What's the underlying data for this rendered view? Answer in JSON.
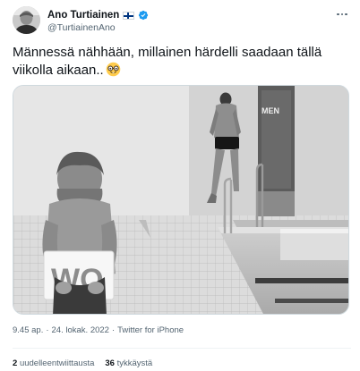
{
  "user": {
    "display_name": "Ano Turtiainen",
    "handle": "@TurtiainenAno",
    "flag": "finland-flag-icon",
    "verified_badge": "verified-badge-icon"
  },
  "tweet": {
    "text": "Männessä nähhään, millainen härdelli saadaan tällä\nviikolla aikaan..",
    "emoji": "nerd-face-icon",
    "media_alt": "",
    "media_signs": {
      "door_sign": "MEN",
      "towel_letters": "WO"
    }
  },
  "meta": {
    "time": "9.45 ap.",
    "date": "24. lokak. 2022",
    "source": "Twitter for iPhone",
    "separator": "·"
  },
  "stats": {
    "retweets_count": "2",
    "retweets_label": "uudelleentwiittausta",
    "likes_count": "36",
    "likes_label": "tykkäystä"
  },
  "colors": {
    "text": "#0f1419",
    "secondary": "#536471",
    "verified_blue": "#1d9bf0",
    "divider": "#eff3f4"
  },
  "icons": [
    "more-icon",
    "verified-badge-icon",
    "finland-flag-icon",
    "nerd-face-icon"
  ]
}
